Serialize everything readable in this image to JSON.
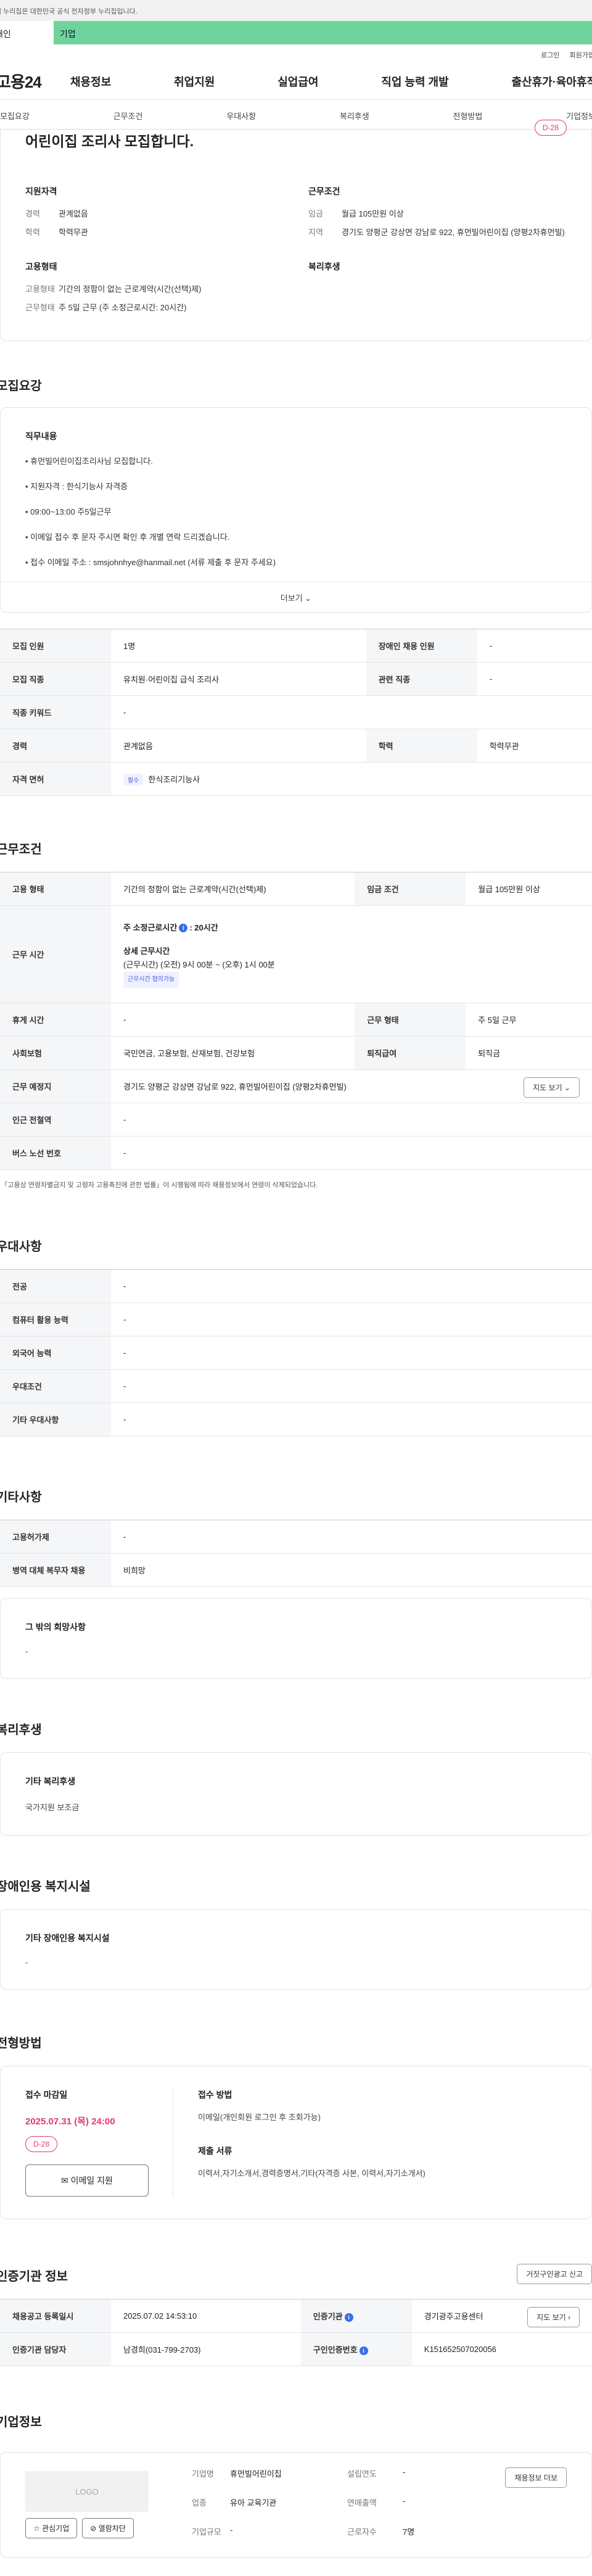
{
  "banner": {
    "text": "이 누리집은 대한민국 공식 전자정부 누리집입니다."
  },
  "user_tabs": {
    "personal": "개인",
    "corporate": "기업"
  },
  "util": {
    "login": "로그인",
    "signup": "회원가입"
  },
  "gnb": {
    "logo": "고용24",
    "menu": [
      "채용정보",
      "취업지원",
      "실업급여",
      "직업 능력 개발",
      "출산휴가·육아휴직"
    ]
  },
  "anchors": [
    "모집요강",
    "근무조건",
    "우대사항",
    "복리후생",
    "전형방법",
    "기업정보"
  ],
  "summary": {
    "title": "어린이집 조리사 모집합니다.",
    "dday": "D-28",
    "qualification": {
      "heading": "지원자격",
      "career_k": "경력",
      "career_v": "관계없음",
      "edu_k": "학력",
      "edu_v": "학력무관"
    },
    "conditions": {
      "heading": "근무조건",
      "wage_k": "임금",
      "wage_v": "월급 105만원 이상",
      "region_k": "지역",
      "region_v": "경기도 양평군 강상면 강남로 922, 휴먼빌어린이집 (양평2차휴먼빌)"
    },
    "employment": {
      "heading": "고용형태",
      "type_k": "고용형태",
      "type_v": "기간의 정함이 없는 근로계약(시간(선택)제)",
      "hours_k": "근무형태",
      "hours_v": "주 5일 근무 (주 소정근로시간: 20시간)"
    },
    "welfare": {
      "heading": "복리후생"
    }
  },
  "recruit": {
    "title": "모집요강",
    "duty_heading": "직무내용",
    "duties": [
      "• 휴먼빌어린이집조리사님 모집합니다.",
      "• 지원자격 : 한식기능사 자격증",
      "• 09:00~13:00 주5일근무",
      "• 이메일 접수 후 문자 주시면 확인 후 개별 연락 드리겠습니다.",
      "• 접수 이메일 주소 : smsjohnhye@hanmail.net (서류 제출 후 문자 주세요)"
    ],
    "more": "더보기 ⌄",
    "rows": [
      {
        "k1": "모집 인원",
        "v1": "1명",
        "k2": "장애인 채용 인원",
        "v2": "-"
      },
      {
        "k1": "모집 직종",
        "v1": "유치원·어린이집 급식 조리사",
        "k2": "관련 직종",
        "v2": "-"
      },
      {
        "k1": "직종 키워드",
        "v1": "-"
      },
      {
        "k1": "경력",
        "v1": "관계없음",
        "k2": "학력",
        "v2": "학력무관"
      },
      {
        "k1": "자격 면허",
        "chip": "필수",
        "v1": "한식조리기능사"
      }
    ]
  },
  "work": {
    "title": "근무조건",
    "emp_type_k": "고용 형태",
    "emp_type_v": "기간의 정함이 없는 근로계약(시간(선택)제)",
    "wage_k": "임금 조건",
    "wage_v": "월급 105만원 이상",
    "time_k": "근무 시간",
    "time_weekly": "주 소정근로시간",
    "time_weekly_v": ": 20시간",
    "time_detail_h": "상세 근무시간",
    "time_detail_v": "(근무시간) (오전) 9시 00분 ~ (오후) 1시 00분",
    "time_chip": "근무시간 협의가능",
    "rest_k": "휴게 시간",
    "rest_v": "-",
    "form_k": "근무 형태",
    "form_v": "주 5일 근무",
    "insurance_k": "사회보험",
    "insurance_v": "국민연금, 고용보험, 산재보험, 건강보험",
    "severance_k": "퇴직급여",
    "severance_v": "퇴직금",
    "place_k": "근무 예정지",
    "place_v": "경기도 양평군 강상면 강남로 922, 휴먼빌어린이집 (양평2차휴먼빌)",
    "map_btn": "지도 보기 ⌄",
    "subway_k": "인근 전철역",
    "subway_v": "-",
    "bus_k": "버스 노선 번호",
    "bus_v": "-",
    "note": "* 「고용상 연령차별금지 및 고령자 고용촉진에 관한 법률」이 시행됨에 따라 채용정보에서 연령이 삭제되었습니다."
  },
  "pref": {
    "title": "우대사항",
    "rows": [
      {
        "k": "전공",
        "v": "-"
      },
      {
        "k": "컴퓨터 활용 능력",
        "v": "-"
      },
      {
        "k": "외국어 능력",
        "v": "-"
      },
      {
        "k": "우대조건",
        "v": "-"
      },
      {
        "k": "기타 우대사항",
        "v": "-"
      }
    ]
  },
  "etc": {
    "title": "기타사항",
    "rows": [
      {
        "k": "고용허가제",
        "v": "-"
      },
      {
        "k": "병역 대체 복무자 채용",
        "v": "비희망"
      }
    ],
    "other_h": "그 밖의 희망사항",
    "other_v": "-"
  },
  "welfare": {
    "title": "복리후생",
    "h": "기타 복리후생",
    "v": "국가지원 보조금"
  },
  "disabled": {
    "title": "장애인용 복지시설",
    "h": "기타 장애인용 복지시설",
    "v": "-"
  },
  "apply": {
    "title": "전형방법",
    "deadline_h": "접수 마감일",
    "deadline_v": "2025.07.31 (목) 24:00",
    "dday": "D-28",
    "email_btn": "✉ 이메일 지원",
    "method_h": "접수 방법",
    "method_v": "이메일(개인회원 로그인 후 조회가능)",
    "docs_h": "제출 서류",
    "docs_v": "이력서,자기소개서,경력증명서,기타(자격증 사본, 이력서,자기소개서)"
  },
  "agency": {
    "title": "인증기관 정보",
    "report_btn": "거짓구인광고 신고",
    "reg_k": "채용공고 등록일시",
    "reg_v": "2025.07.02 14:53:10",
    "org_k": "인증기관",
    "org_v": "경기광주고용센터",
    "map_btn": "지도 보기 ›",
    "mgr_k": "인증기관 담당자",
    "mgr_v": "남경희(031-799-2703)",
    "auth_k": "구인인증번호",
    "auth_v": "K151652507020056"
  },
  "company": {
    "title": "기업정보",
    "logo": "LOGO",
    "fav_btn": "☆ 관심기업",
    "block_btn": "⊘ 열람차단",
    "name_k": "기업명",
    "name_v": "휴먼빌어린이집",
    "year_k": "설립연도",
    "year_v": "-",
    "industry_k": "업종",
    "industry_v": "유아 교육기관",
    "sales_k": "연매출액",
    "sales_v": "-",
    "size_k": "기업규모",
    "size_v": "-",
    "staff_k": "근로자수",
    "staff_v": "7명",
    "more_btn": "채용정보 더보"
  }
}
